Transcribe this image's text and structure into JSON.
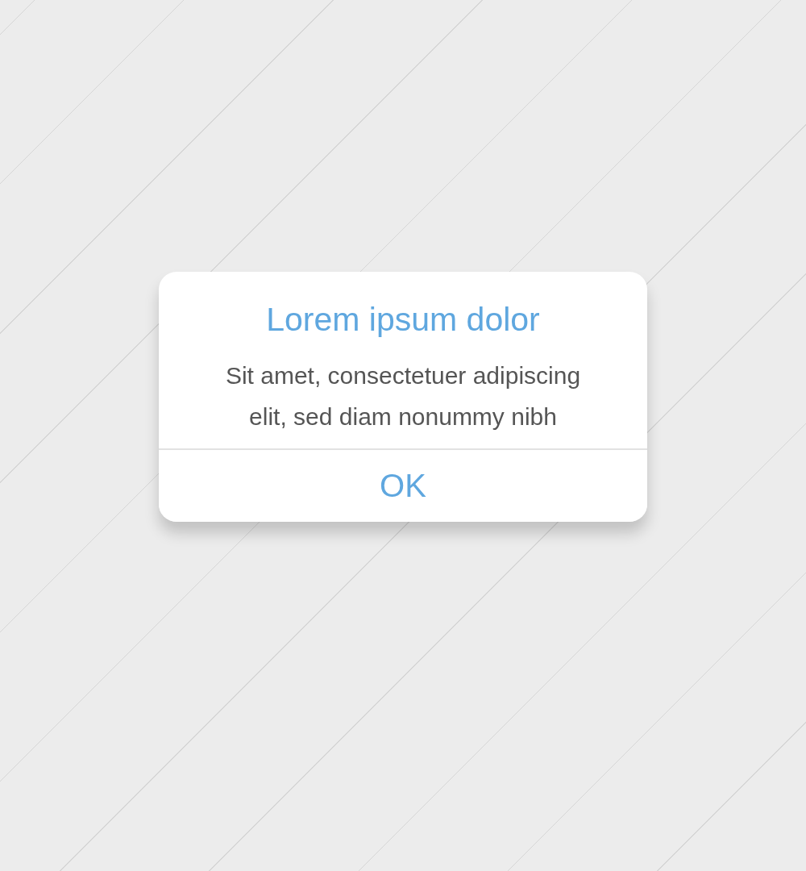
{
  "dialog": {
    "title": "Lorem ipsum dolor",
    "message": "Sit amet, consectetuer adipiscing elit, sed diam nonummy nibh",
    "buttons": [
      "OK"
    ]
  }
}
